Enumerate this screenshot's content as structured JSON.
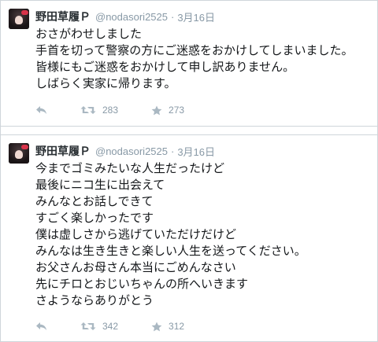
{
  "tweets": [
    {
      "name": "野田草履Ｐ",
      "handle": "@nodasori2525",
      "separator": "·",
      "time": "3月16日",
      "lines": [
        "おさがわせしました",
        "手首を切って警察の方にご迷惑をおかけしてしまいました。",
        "皆様にもご迷惑をおかけして申し訳ありません。",
        "しばらく実家に帰ります。"
      ],
      "retweets": "283",
      "favorites": "273"
    },
    {
      "name": "野田草履Ｐ",
      "handle": "@nodasori2525",
      "separator": "·",
      "time": "3月16日",
      "lines": [
        "今までゴミみたいな人生だったけど",
        "最後にニコ生に出会えて",
        "みんなとお話しできて",
        "すごく楽しかったです",
        "僕は虚しさから逃げていただけだけど",
        "みんなは生き生きと楽しい人生を送ってください。",
        "お父さんお母さん本当にごめんなさい",
        "先にチロとおじいちゃんの所へいきます",
        "さようならありがとう"
      ],
      "retweets": "342",
      "favorites": "312"
    }
  ],
  "icons": {
    "reply": "reply-icon",
    "retweet": "retweet-icon",
    "favorite": "star-icon"
  },
  "colors": {
    "meta": "#8899a6",
    "text": "#14171a",
    "border": "#cfd5da"
  }
}
